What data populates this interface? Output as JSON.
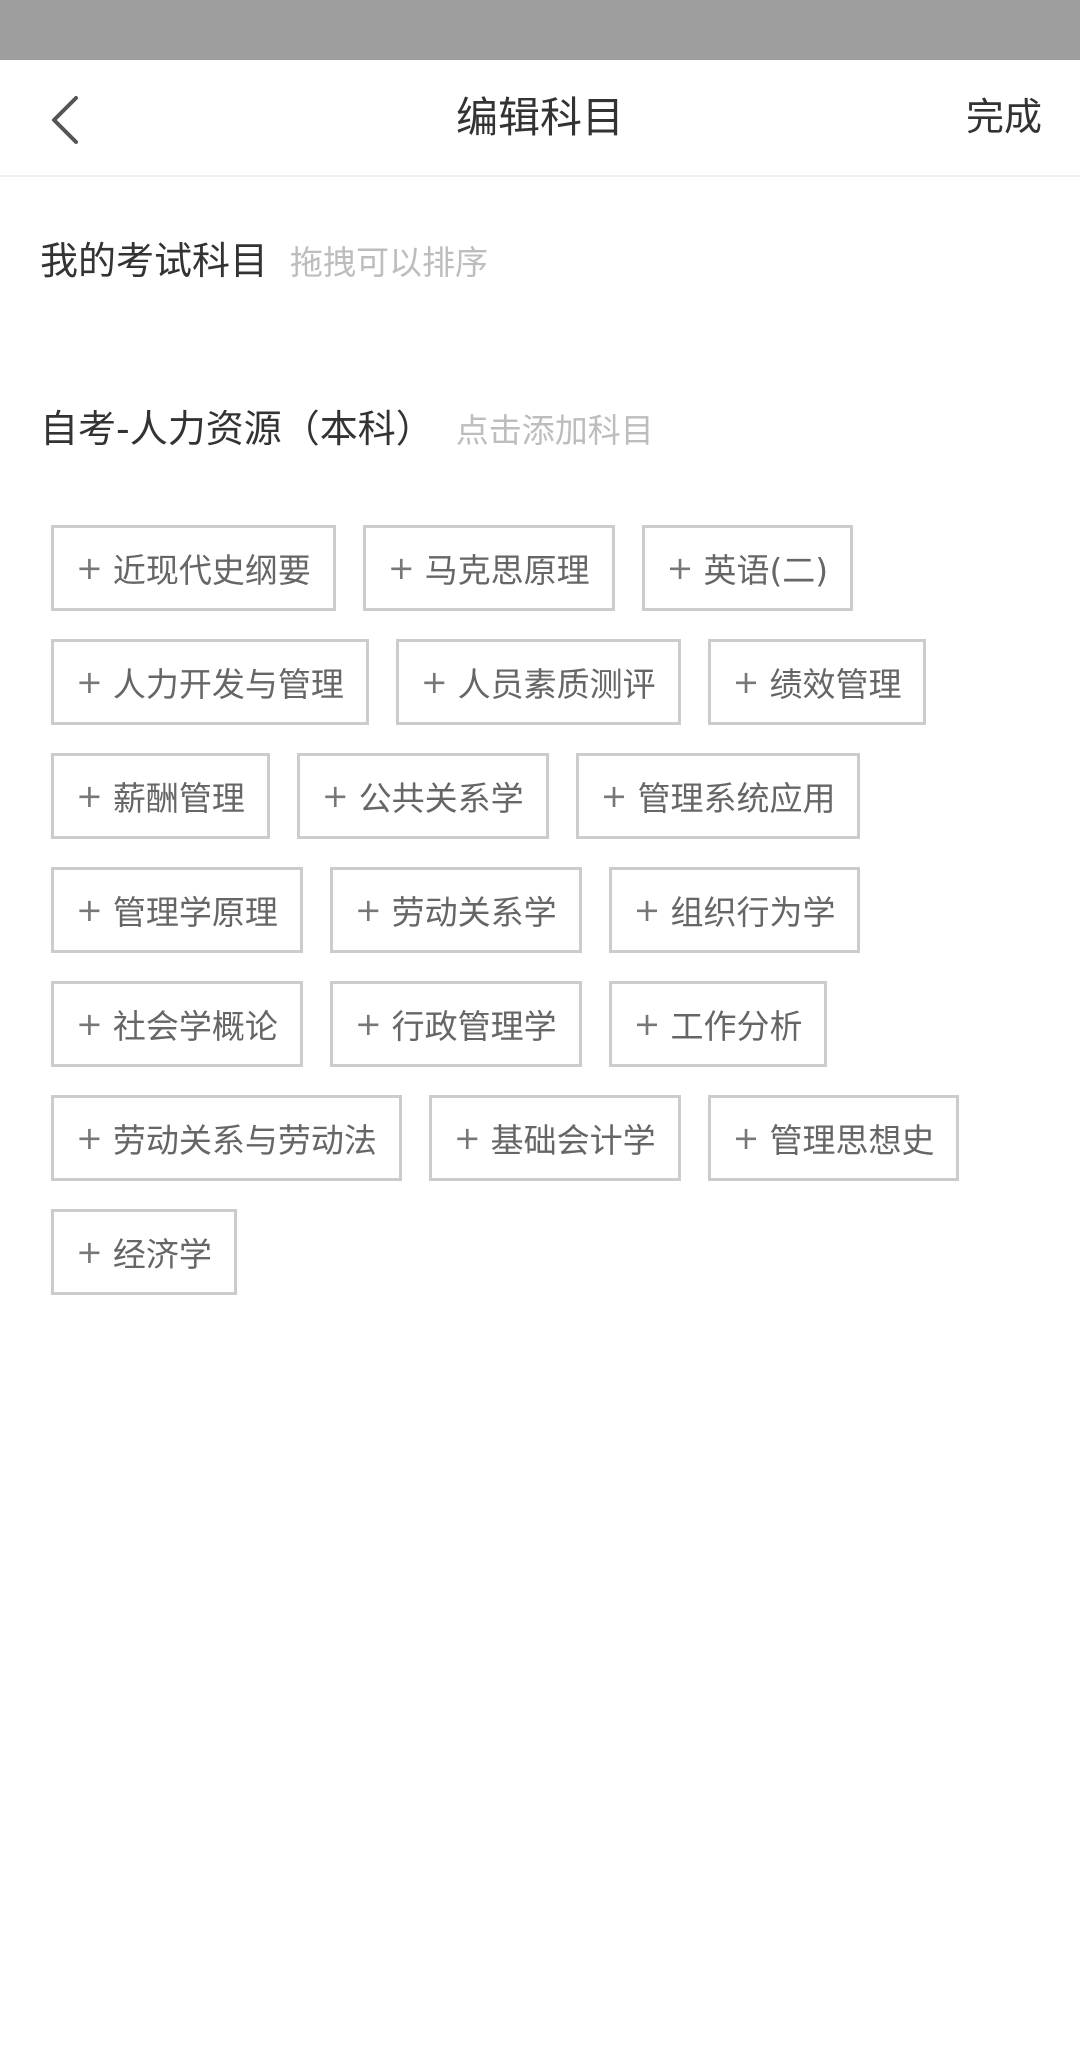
{
  "nav": {
    "title": "编辑科目",
    "done_label": "完成"
  },
  "my_subjects": {
    "title": "我的考试科目",
    "hint": "拖拽可以排序"
  },
  "program": {
    "title": "自考-人力资源（本科）",
    "hint": "点击添加科目"
  },
  "plus_symbol": "+",
  "subjects": [
    "近现代史纲要",
    "马克思原理",
    "英语(二)",
    "人力开发与管理",
    "人员素质测评",
    "绩效管理",
    "薪酬管理",
    "公共关系学",
    "管理系统应用",
    "管理学原理",
    "劳动关系学",
    "组织行为学",
    "社会学概论",
    "行政管理学",
    "工作分析",
    "劳动关系与劳动法",
    "基础会计学",
    "管理思想史",
    "经济学"
  ]
}
